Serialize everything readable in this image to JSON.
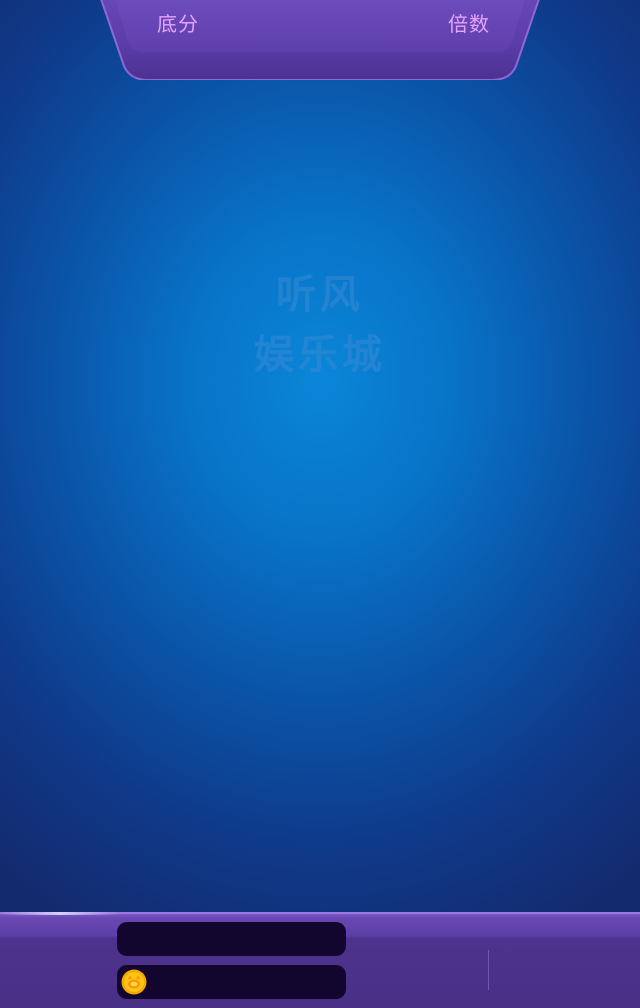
{
  "top_panel": {
    "base_score_label": "底分",
    "multiplier_label": "倍数"
  },
  "watermark": {
    "line1": "听风",
    "line2": "娱乐城"
  },
  "player": {
    "name": "",
    "coins": ""
  },
  "colors": {
    "background_center": "#0a86d8",
    "background_edge": "#142a6e",
    "panel_purple": "#5c3ea4",
    "label_pink": "#e6a4ff",
    "info_box": "#12062e",
    "coin_gold": "#ffc21a"
  },
  "icons": {
    "coin": "gold-coin-icon"
  }
}
